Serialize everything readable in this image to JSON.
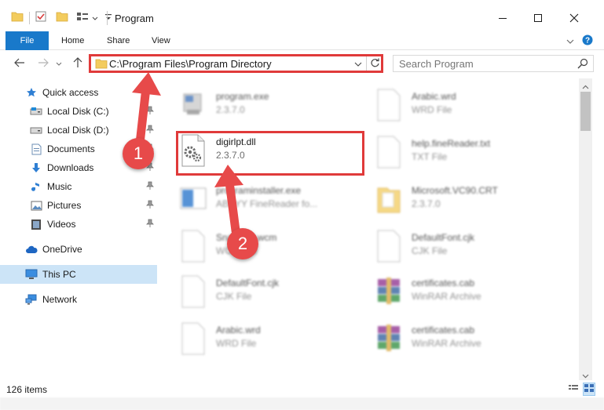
{
  "window": {
    "title": "Program"
  },
  "ribbon": {
    "tabs": [
      {
        "label": "File"
      },
      {
        "label": "Home"
      },
      {
        "label": "Share"
      },
      {
        "label": "View"
      }
    ]
  },
  "address": {
    "path": "C:\\Program Files\\Program Directory"
  },
  "search": {
    "placeholder": "Search Program"
  },
  "sidebar": {
    "items": [
      {
        "label": "Quick access",
        "icon": "star-icon"
      },
      {
        "label": "Local Disk (C:)",
        "icon": "drive-icon",
        "pinned": true
      },
      {
        "label": "Local Disk (D:)",
        "icon": "drive-icon",
        "pinned": true
      },
      {
        "label": "Documents",
        "icon": "documents-icon",
        "pinned": true
      },
      {
        "label": "Downloads",
        "icon": "downloads-icon",
        "pinned": true
      },
      {
        "label": "Music",
        "icon": "music-icon",
        "pinned": true
      },
      {
        "label": "Pictures",
        "icon": "pictures-icon",
        "pinned": true
      },
      {
        "label": "Videos",
        "icon": "videos-icon",
        "pinned": true
      },
      {
        "label": "OneDrive",
        "icon": "cloud-icon"
      },
      {
        "label": "This PC",
        "icon": "computer-icon",
        "selected": true
      },
      {
        "label": "Network",
        "icon": "network-icon"
      }
    ]
  },
  "files": [
    {
      "name": "program.exe",
      "sub": "2.3.7.0",
      "icon": "exe-icon",
      "blurred": true
    },
    {
      "name": "Arabic.wrd",
      "sub": "WRD File",
      "icon": "document-icon",
      "blurred": true
    },
    {
      "name": "digirlpt.dll",
      "sub": "2.3.7.0",
      "icon": "dll-gear-icon",
      "blurred": false,
      "highlighted": true
    },
    {
      "name": "help.fineReader.txt",
      "sub": "TXT File",
      "icon": "document-icon",
      "blurred": true
    },
    {
      "name": "programinstaller.exe",
      "sub": "ABBYY FineReader fo...",
      "icon": "installer-icon",
      "blurred": true
    },
    {
      "name": "Microsoft.VC90.CRT",
      "sub": "2.3.7.0",
      "icon": "folder-icon",
      "blurred": true
    },
    {
      "name": "SnapP10.wcm",
      "sub": "WCM File",
      "icon": "document-icon",
      "blurred": true
    },
    {
      "name": "DefaultFont.cjk",
      "sub": "CJK File",
      "icon": "document-icon",
      "blurred": true
    },
    {
      "name": "DefaultFont.cjk",
      "sub": "CJK File",
      "icon": "document-icon",
      "blurred": true
    },
    {
      "name": "certificates.cab",
      "sub": "WinRAR Archive",
      "icon": "winrar-icon",
      "blurred": true
    },
    {
      "name": "Arabic.wrd",
      "sub": "WRD File",
      "icon": "document-icon",
      "blurred": true
    },
    {
      "name": "certificates.cab",
      "sub": "WinRAR Archive",
      "icon": "winrar-icon",
      "blurred": true
    }
  ],
  "status": {
    "item_count": "126 items"
  },
  "callouts": [
    {
      "label": "1"
    },
    {
      "label": "2"
    }
  ],
  "colors": {
    "accent": "#1979ca",
    "annotation": "#e03a3a",
    "selection": "#cce4f7"
  }
}
